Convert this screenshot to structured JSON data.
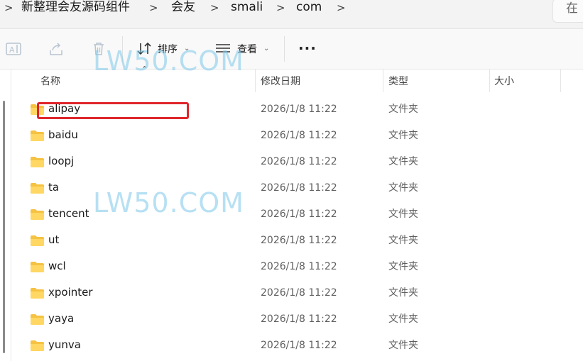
{
  "breadcrumb": {
    "items": [
      "新整理会友源码组件",
      "会友",
      "smali",
      "com"
    ],
    "separator": ">"
  },
  "search": {
    "placeholder": "在"
  },
  "toolbar": {
    "sort_label": "排序",
    "view_label": "查看",
    "more_label": "···"
  },
  "columns": {
    "name": "名称",
    "date": "修改日期",
    "type": "类型",
    "size": "大小"
  },
  "files": [
    {
      "name": "alipay",
      "date": "2026/1/8 11:22",
      "type": "文件夹"
    },
    {
      "name": "baidu",
      "date": "2026/1/8 11:22",
      "type": "文件夹"
    },
    {
      "name": "loopj",
      "date": "2026/1/8 11:22",
      "type": "文件夹"
    },
    {
      "name": "ta",
      "date": "2026/1/8 11:22",
      "type": "文件夹"
    },
    {
      "name": "tencent",
      "date": "2026/1/8 11:22",
      "type": "文件夹"
    },
    {
      "name": "ut",
      "date": "2026/1/8 11:22",
      "type": "文件夹"
    },
    {
      "name": "wcl",
      "date": "2026/1/8 11:22",
      "type": "文件夹"
    },
    {
      "name": "xpointer",
      "date": "2026/1/8 11:22",
      "type": "文件夹"
    },
    {
      "name": "yaya",
      "date": "2026/1/8 11:22",
      "type": "文件夹"
    },
    {
      "name": "yunva",
      "date": "2026/1/8 11:22",
      "type": "文件夹"
    }
  ],
  "watermark": "LW50.COM",
  "colors": {
    "folder": "#f5c242",
    "highlight": "#e0252b",
    "watermark": "#7ec8ea"
  }
}
